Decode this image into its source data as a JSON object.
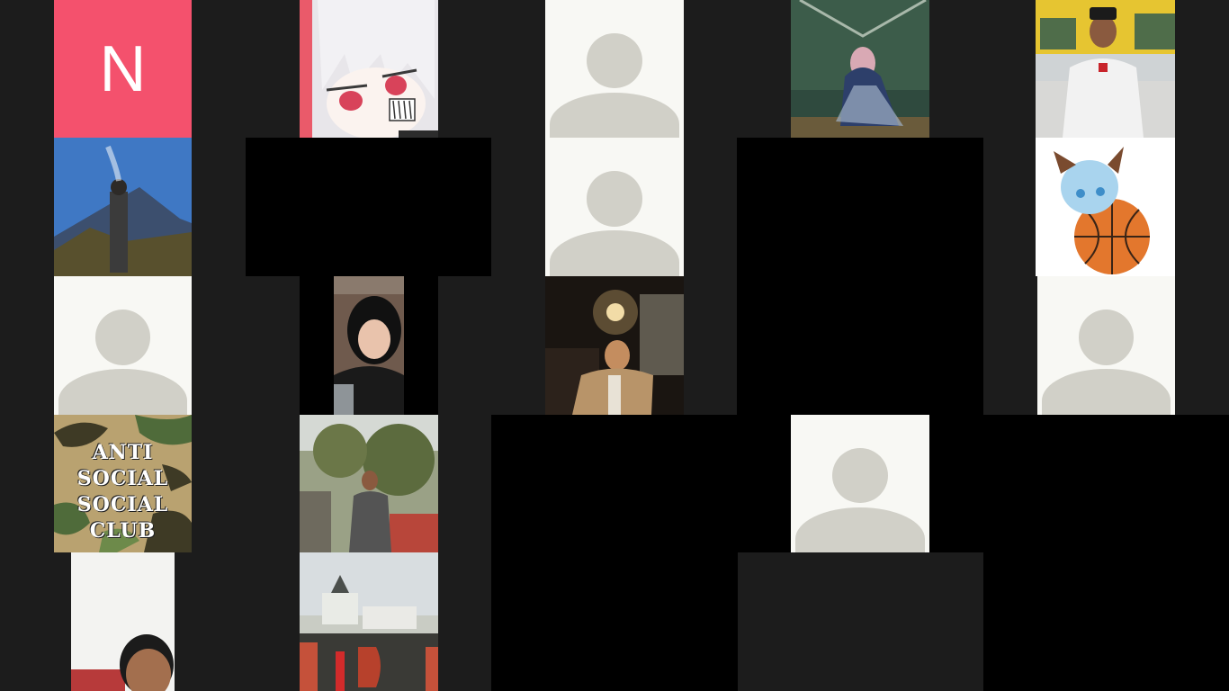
{
  "participants": [
    {
      "id": "p1",
      "kind": "letter",
      "letter": "N",
      "color": "#f4516d"
    },
    {
      "id": "p2",
      "kind": "photo",
      "desc": "anime-girl-avatar"
    },
    {
      "id": "p3",
      "kind": "default"
    },
    {
      "id": "p4",
      "kind": "photo",
      "desc": "tent-photo"
    },
    {
      "id": "p5",
      "kind": "photo",
      "desc": "uniform-photo"
    },
    {
      "id": "p6",
      "kind": "photo",
      "desc": "mountain-photo"
    },
    {
      "id": "p7",
      "kind": "blank"
    },
    {
      "id": "p8",
      "kind": "default"
    },
    {
      "id": "p9",
      "kind": "blank"
    },
    {
      "id": "p10",
      "kind": "photo",
      "desc": "anime-cat-basketball"
    },
    {
      "id": "p11",
      "kind": "default"
    },
    {
      "id": "p12",
      "kind": "photo",
      "desc": "selfie-photo"
    },
    {
      "id": "p13",
      "kind": "photo",
      "desc": "night-cafe-photo"
    },
    {
      "id": "p14",
      "kind": "blank"
    },
    {
      "id": "p15",
      "kind": "default"
    },
    {
      "id": "p16",
      "kind": "photo",
      "desc": "camo-text-avatar"
    },
    {
      "id": "p17",
      "kind": "photo",
      "desc": "forest-portrait-photo"
    },
    {
      "id": "p18",
      "kind": "blank"
    },
    {
      "id": "p19",
      "kind": "default"
    },
    {
      "id": "p20",
      "kind": "blank"
    },
    {
      "id": "p21",
      "kind": "photo",
      "desc": "live-camera-feed"
    },
    {
      "id": "p22",
      "kind": "photo",
      "desc": "building-photo"
    },
    {
      "id": "p23",
      "kind": "blank"
    }
  ],
  "camo_avatar_text": [
    "ANTI",
    "SOCIAL",
    "SOCIAL",
    "CLUB"
  ],
  "letter_avatar": "N",
  "colors": {
    "background": "#1c1c1c",
    "letter_tile": "#f4516d",
    "default_avatar_bg": "#f8f8f4",
    "default_avatar_fg": "#d1d0c8"
  }
}
